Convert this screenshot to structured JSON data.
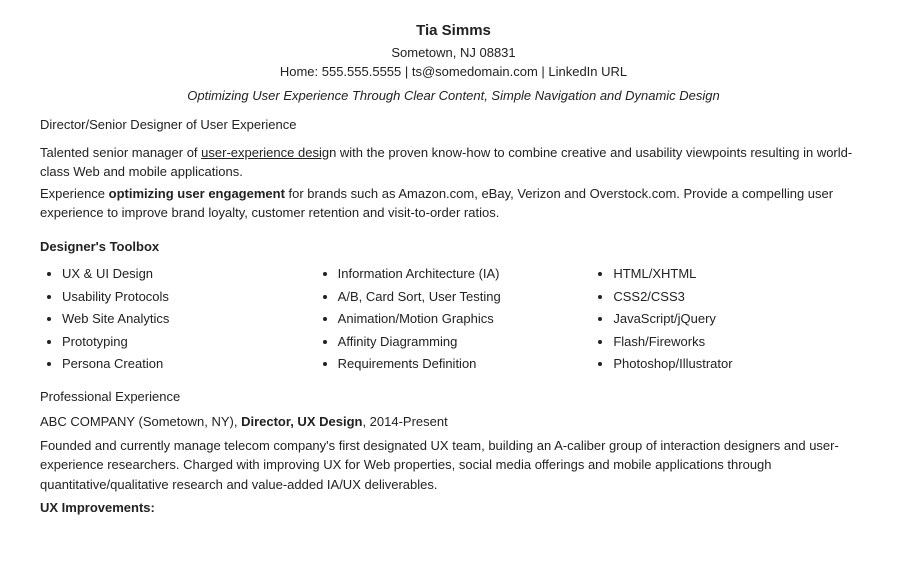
{
  "header": {
    "name": "Tia Simms",
    "location": "Sometown, NJ 08831",
    "contact": "Home: 555.555.5555 | ts@somedomain.com | LinkedIn URL",
    "tagline": "Optimizing User Experience Through Clear Content, Simple Navigation and Dynamic Design"
  },
  "director_title": "Director/Senior Designer of User Experience",
  "summary": {
    "line1_prefix": "Talented senior manager of ",
    "line1_bold": "user-experience desig",
    "line1_suffix": "n with the proven know-how to combine creative and usability viewpoints resulting in world-class Web and mobile applications.",
    "line2_prefix": "Experience ",
    "line2_bold": "optimizing user engagement",
    "line2_suffix": " for brands such as Amazon.com, eBay, Verizon and Overstock.com. Provide a compelling user experience to improve brand loyalty, customer retention and visit-to-order ratios."
  },
  "toolbox": {
    "title": "Designer's Toolbox",
    "col1": [
      "UX & UI Design",
      "Usability Protocols",
      "Web Site Analytics",
      "Prototyping",
      "Persona Creation"
    ],
    "col2": [
      "Information Architecture (IA)",
      "A/B, Card Sort, User Testing",
      "Animation/Motion Graphics",
      "Affinity Diagramming",
      "Requirements Definition"
    ],
    "col3": [
      "HTML/XHTML",
      "CSS2/CSS3",
      "JavaScript/jQuery",
      "Flash/Fireworks",
      "Photoshop/Illustrator"
    ]
  },
  "professional_experience": {
    "section_label": "Professional Experience",
    "job1": {
      "company": "ABC COMPANY (Sometown, NY), ",
      "title": "Director, UX Design",
      "dates": ", 2014-Present",
      "desc": "Founded and currently manage telecom company's first designated UX team, building an A-caliber group of interaction designers and user-experience researchers. Charged with improving UX for Web properties, social media offerings and mobile applications through quantitative/qualitative research and value-added IA/UX deliverables.",
      "ux_label": "UX Improvements:"
    }
  }
}
